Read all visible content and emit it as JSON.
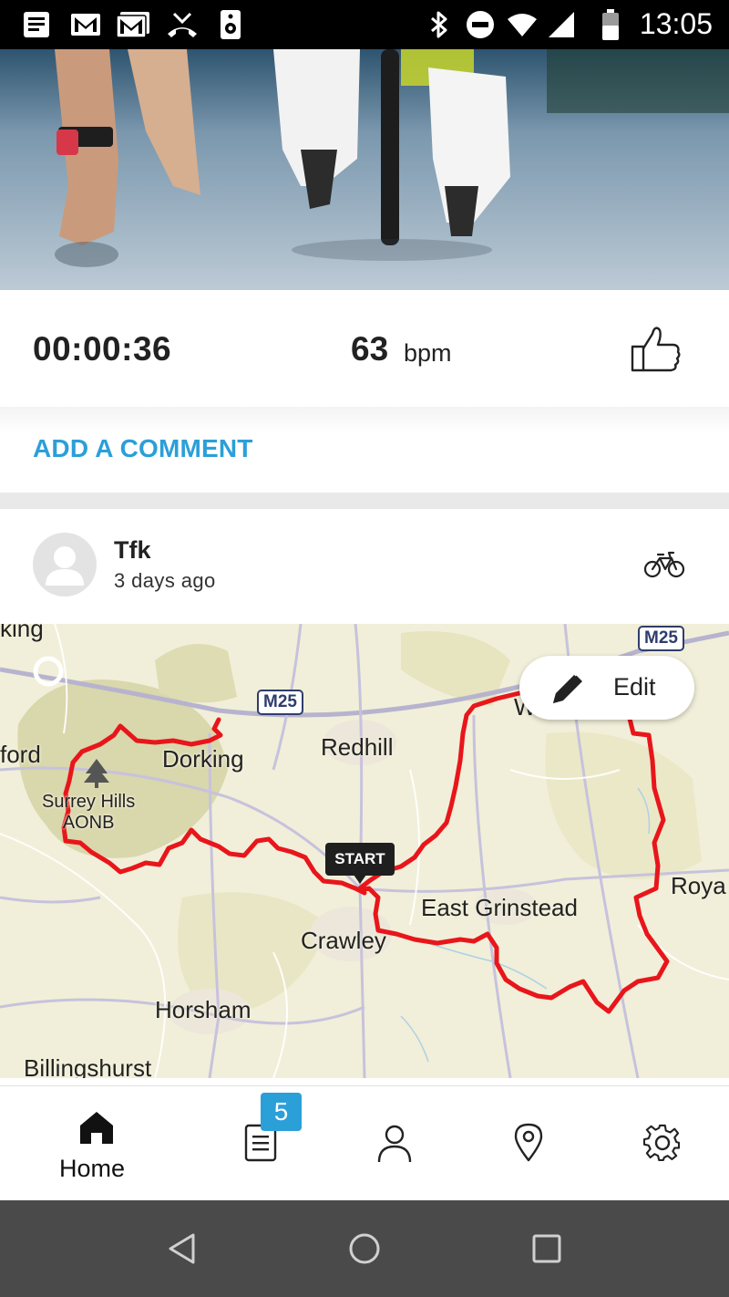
{
  "status_bar": {
    "time": "13:05",
    "left_icons": [
      "news-icon",
      "gmail-icon",
      "gmail-icon",
      "missed-call-icon",
      "speaker-icon"
    ],
    "right_icons": [
      "bluetooth-icon",
      "do-not-disturb-icon",
      "wifi-icon",
      "signal-icon",
      "battery-icon"
    ]
  },
  "activity": {
    "duration": "00:00:36",
    "heart_rate_value": "63",
    "heart_rate_unit": "bpm",
    "add_comment_label": "ADD A COMMENT"
  },
  "post": {
    "username": "Tfk",
    "time_ago": "3 days ago",
    "sport_icon": "bicycle-icon",
    "map": {
      "edit_label": "Edit",
      "start_label": "START",
      "places": {
        "king": "king",
        "ford": "ford",
        "dorking": "Dorking",
        "surrey_hills_1": "Surrey Hills",
        "surrey_hills_2": "AONB",
        "redhill": "Redhill",
        "east_grinstead": "East Grinstead",
        "crawley": "Crawley",
        "horsham": "Horsham",
        "billingshurst": "Billingshurst",
        "roya": "Roya",
        "w": "W"
      },
      "motorways": {
        "m25_a": "M25",
        "m25_b": "M25"
      },
      "route_color": "#e8161b"
    }
  },
  "tab_bar": {
    "home_label": "Home",
    "diary_badge": "5",
    "accent": "#2b9fd8"
  }
}
